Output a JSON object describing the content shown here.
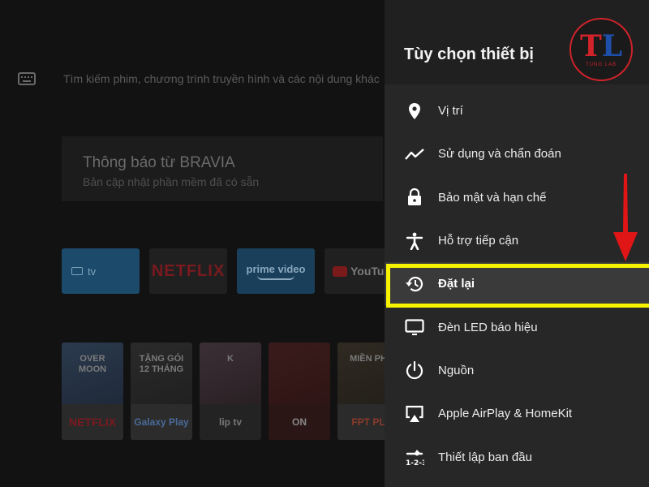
{
  "home": {
    "search_placeholder": "Tìm kiếm phim, chương trình truyền hình và các nội dung khác",
    "notice_title": "Thông báo từ BRAVIA",
    "notice_subtitle": "Bản cập nhật phần mềm đã có sẵn",
    "apps": [
      {
        "label": "tv",
        "icon": "tv-icon"
      },
      {
        "label": "NETFLIX"
      },
      {
        "label": "prime video"
      },
      {
        "label": "YouTube",
        "icon": "youtube-play-icon"
      }
    ],
    "posters": [
      {
        "title": "OVER MOON",
        "band": "NETFLIX"
      },
      {
        "title": "TẶNG GÓI 12 THÁNG",
        "band": "Galaxy Play"
      },
      {
        "title": "K",
        "band": "lip tv"
      },
      {
        "title": "",
        "band": "ON"
      },
      {
        "title": "MIỀN PH",
        "band": "FPT PL"
      }
    ]
  },
  "panel": {
    "title": "Tùy chọn thiết bị",
    "logo": {
      "letters_t": "T",
      "letters_l": "L",
      "sub": "TUNG LAB",
      "colors": {
        "red": "#d1232a",
        "blue": "#1e4fa8"
      }
    },
    "items": [
      {
        "label": "Vị trí",
        "icon": "location-pin-icon"
      },
      {
        "label": "Sử dụng và chẩn đoán",
        "icon": "trend-line-icon"
      },
      {
        "label": "Bảo mật và hạn chế",
        "icon": "lock-icon"
      },
      {
        "label": "Hỗ trợ tiếp cận",
        "icon": "accessibility-icon"
      },
      {
        "label": "Đặt lại",
        "icon": "history-reset-icon",
        "selected": true
      },
      {
        "label": "Đèn LED báo hiệu",
        "icon": "led-screen-icon"
      },
      {
        "label": "Nguồn",
        "icon": "power-icon"
      },
      {
        "label": "Apple AirPlay & HomeKit",
        "icon": "airplay-icon"
      },
      {
        "label": "Thiết lập ban đầu",
        "icon": "setup-tools-icon"
      }
    ]
  },
  "annotation": {
    "highlight_color": "#f6f200",
    "arrow_color": "#e01616"
  }
}
